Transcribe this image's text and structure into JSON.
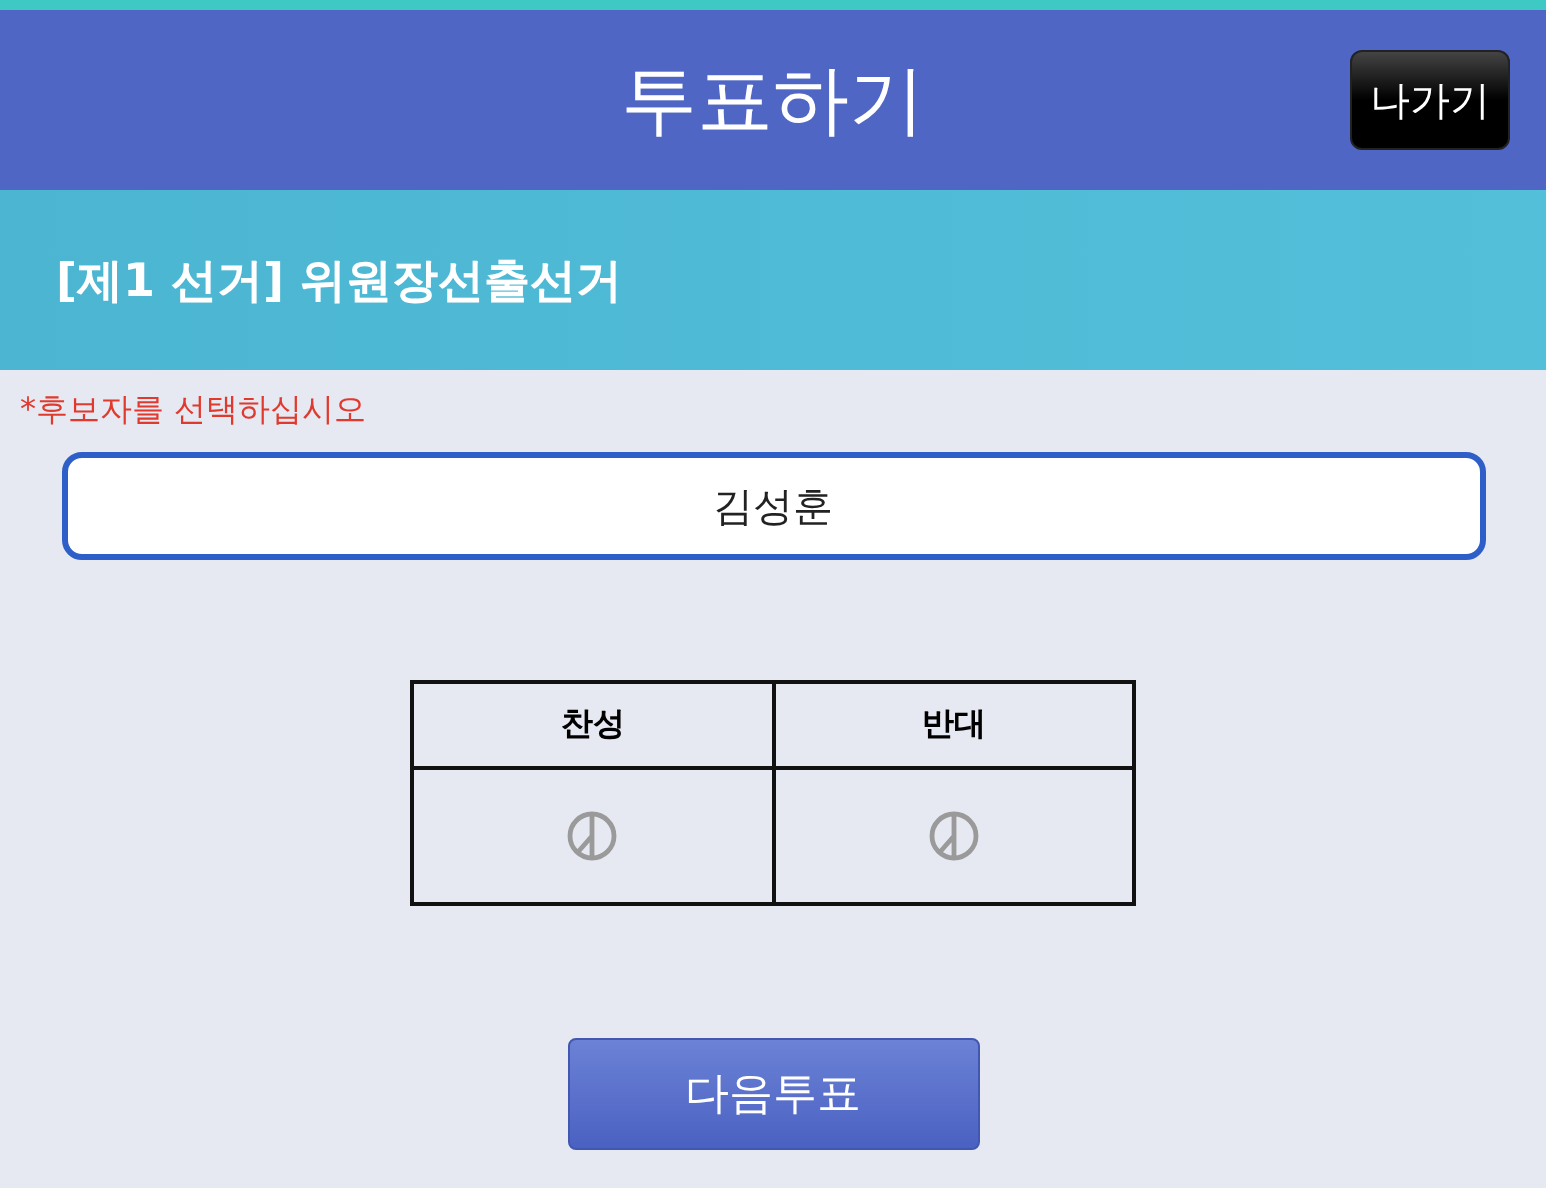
{
  "header": {
    "title": "투표하기",
    "exit_button": "나가기"
  },
  "election": {
    "title": "[제1 선거] 위원장선출선거"
  },
  "instruction": "*후보자를 선택하십시오",
  "candidate": {
    "value": "김성훈"
  },
  "options": [
    {
      "label": "찬성",
      "selected": false
    },
    {
      "label": "반대",
      "selected": false
    }
  ],
  "next_button": "다음투표"
}
